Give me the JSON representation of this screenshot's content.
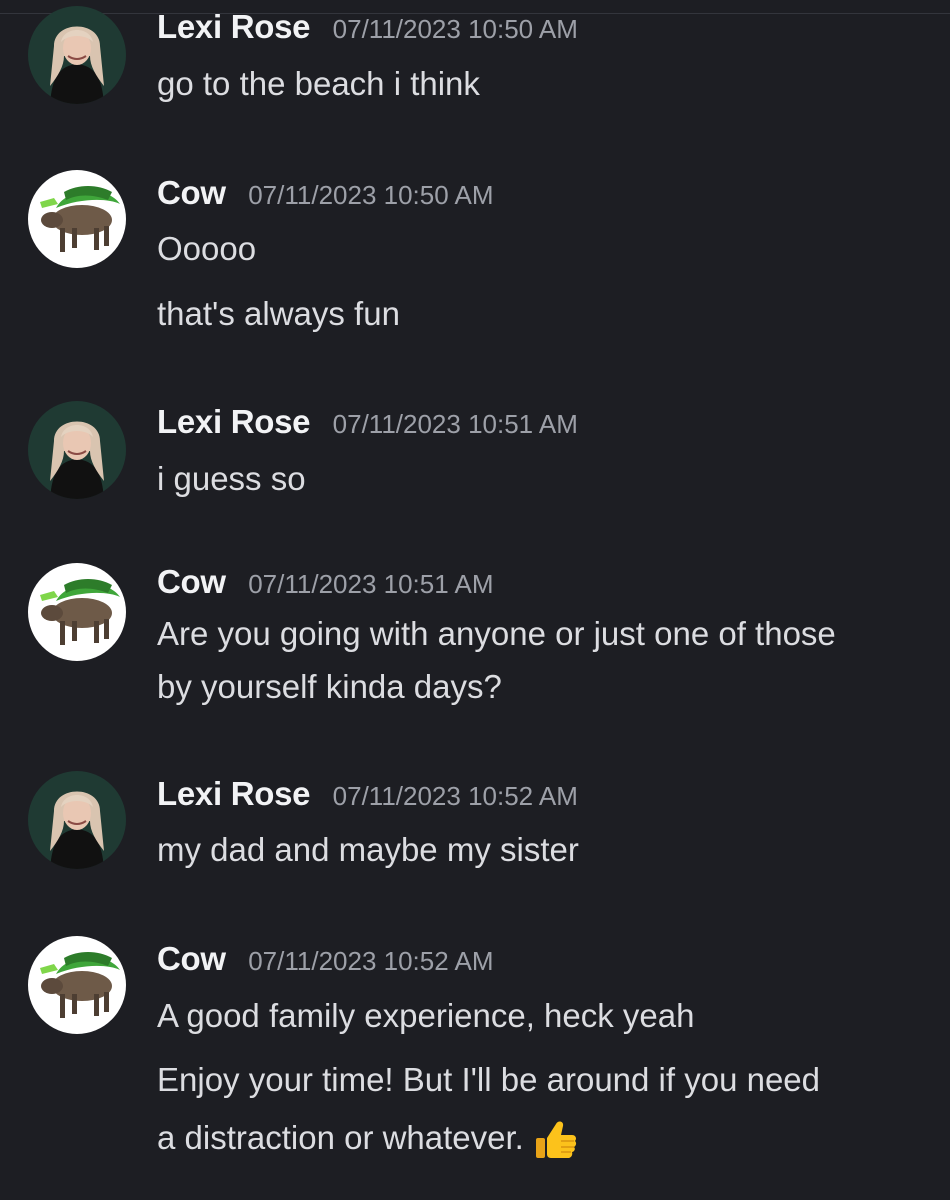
{
  "colors": {
    "background": "#1d1e23",
    "author": "#f2f3f5",
    "timestamp": "#9da0a8",
    "text": "#dcdde1"
  },
  "messages": [
    {
      "author": "Lexi Rose",
      "timestamp": "07/11/2023 10:50 AM",
      "avatar_icon": "lexi-avatar-icon",
      "lines": [
        "go to the beach i think"
      ]
    },
    {
      "author": "Cow",
      "timestamp": "07/11/2023 10:50 AM",
      "avatar_icon": "cow-avatar-icon",
      "lines": [
        "Ooooo",
        "that's always fun"
      ]
    },
    {
      "author": "Lexi Rose",
      "timestamp": "07/11/2023 10:51 AM",
      "avatar_icon": "lexi-avatar-icon",
      "lines": [
        "i guess so"
      ]
    },
    {
      "author": "Cow",
      "timestamp": "07/11/2023 10:51 AM",
      "avatar_icon": "cow-avatar-icon",
      "lines": [
        "Are you going with anyone or just one of those",
        "by yourself kinda days?"
      ]
    },
    {
      "author": "Lexi Rose",
      "timestamp": "07/11/2023 10:52 AM",
      "avatar_icon": "lexi-avatar-icon",
      "lines": [
        "my dad and maybe my sister"
      ]
    },
    {
      "author": "Cow",
      "timestamp": "07/11/2023 10:52 AM",
      "avatar_icon": "cow-avatar-icon",
      "lines": [
        "A good family experience, heck yeah",
        "Enjoy your time! But I'll be around if you need",
        "a distraction or whatever."
      ],
      "end_emoji": "thumbs-up-icon"
    }
  ]
}
